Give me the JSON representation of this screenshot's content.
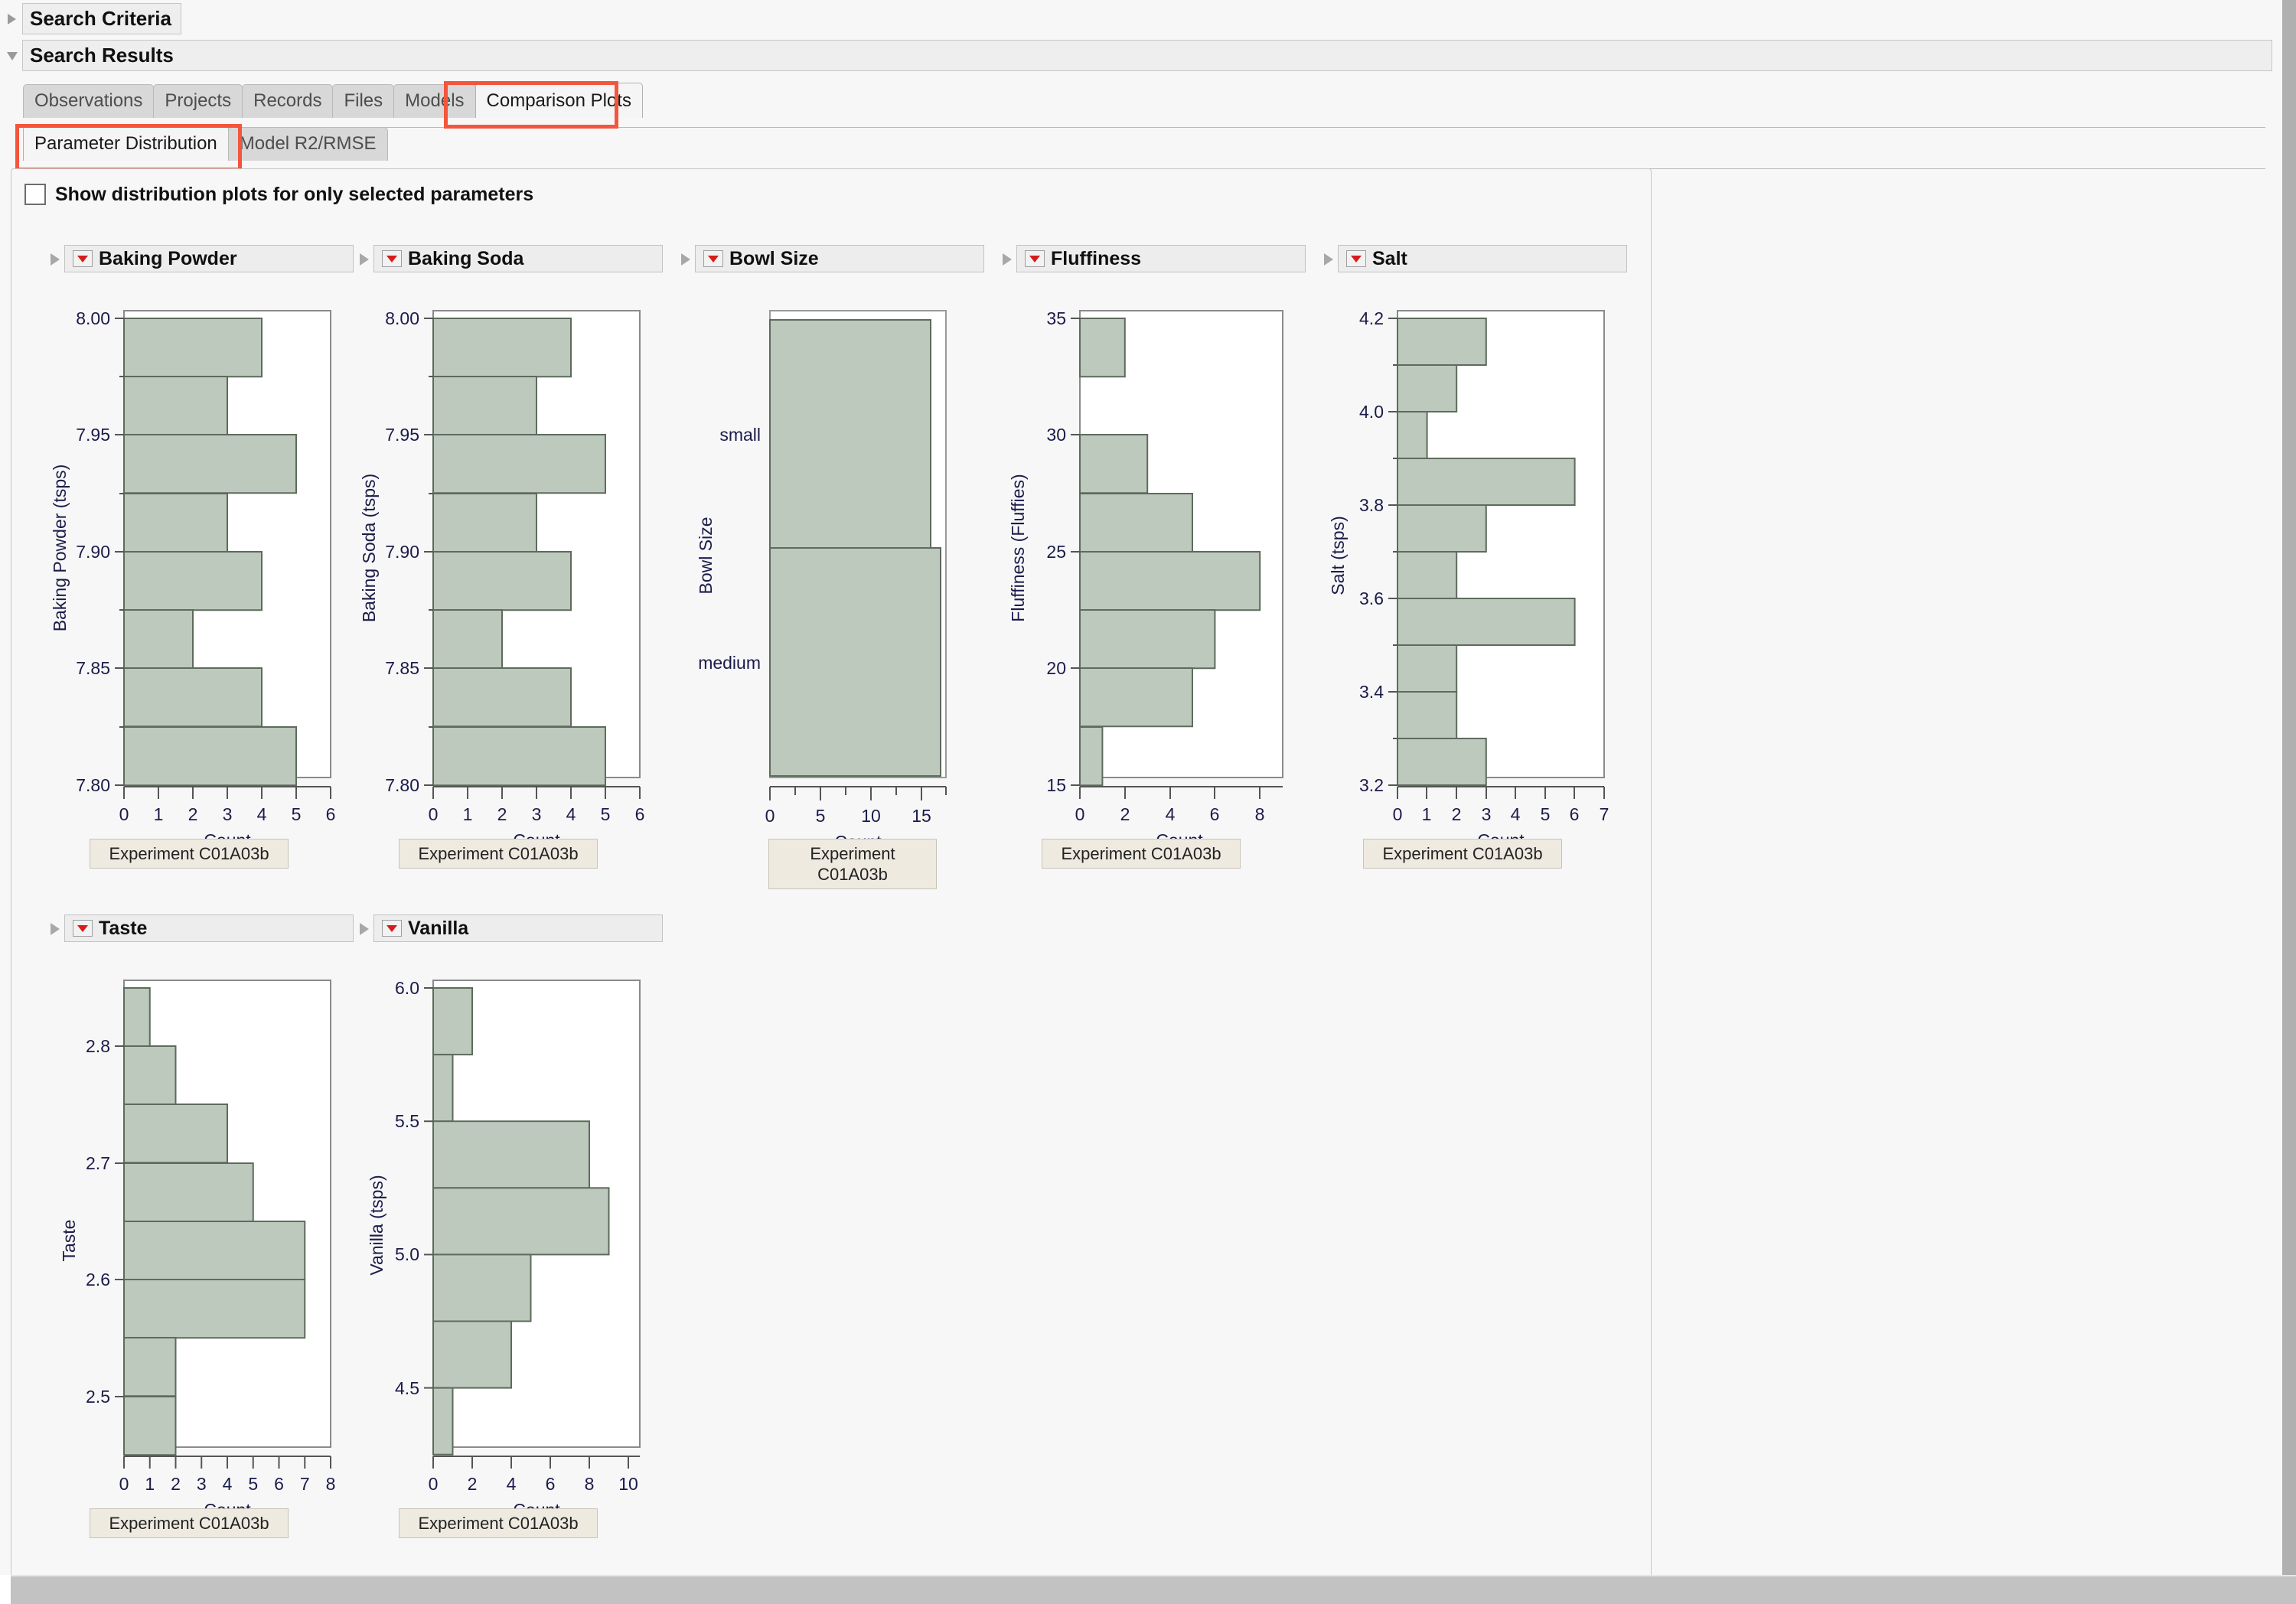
{
  "window": {
    "sections": [
      {
        "name": "search-criteria",
        "title": "Search Criteria",
        "expanded": false
      },
      {
        "name": "search-results",
        "title": "Search Results",
        "expanded": true
      }
    ]
  },
  "tabs_primary": {
    "items": [
      {
        "label": "Observations",
        "active": false
      },
      {
        "label": "Projects",
        "active": false
      },
      {
        "label": "Records",
        "active": false
      },
      {
        "label": "Files",
        "active": false
      },
      {
        "label": "Models",
        "active": false
      },
      {
        "label": "Comparison Plots",
        "active": true
      }
    ],
    "highlight_color": "#f4553d"
  },
  "tabs_secondary": {
    "items": [
      {
        "label": "Parameter Distribution",
        "active": true
      },
      {
        "label": "Model R2/RMSE",
        "active": false
      }
    ]
  },
  "options": {
    "show_selected_only_label": "Show distribution plots for only selected parameters",
    "show_selected_only_checked": false
  },
  "colors": {
    "bar_fill": "#bdc9bc",
    "bar_stroke": "#5d6b5d",
    "axis": "#555555",
    "tick_text": "#1b1b4a",
    "panel_bg": "#f7f7f7",
    "highlight": "#f4553d"
  },
  "plots": [
    {
      "name": "baking-powder",
      "title": "Baking Powder",
      "experiment_label": "Experiment C01A03b",
      "experiment_label_wrapped": false
    },
    {
      "name": "baking-soda",
      "title": "Baking Soda",
      "experiment_label": "Experiment C01A03b",
      "experiment_label_wrapped": false
    },
    {
      "name": "bowl-size",
      "title": "Bowl Size",
      "experiment_label": "Experiment\nC01A03b",
      "experiment_label_wrapped": true
    },
    {
      "name": "fluffiness",
      "title": "Fluffiness",
      "experiment_label": "Experiment C01A03b",
      "experiment_label_wrapped": false
    },
    {
      "name": "salt",
      "title": "Salt",
      "experiment_label": "Experiment C01A03b",
      "experiment_label_wrapped": false
    },
    {
      "name": "taste",
      "title": "Taste",
      "experiment_label": "Experiment C01A03b",
      "experiment_label_wrapped": false
    },
    {
      "name": "vanilla",
      "title": "Vanilla",
      "experiment_label": "Experiment C01A03b",
      "experiment_label_wrapped": false
    }
  ],
  "chart_data": [
    {
      "name": "baking-powder",
      "type": "bar",
      "orientation": "horizontal",
      "title": "Baking Powder",
      "ylabel": "Baking Powder (tsps)",
      "xlabel": "Count",
      "ylim": [
        7.775,
        8.0
      ],
      "xlim": [
        0,
        6
      ],
      "ytick_labels": [
        "7.80",
        "7.85",
        "7.90",
        "7.95",
        "8.00"
      ],
      "ytick_values": [
        7.8,
        7.85,
        7.9,
        7.95,
        8.0
      ],
      "xtick_labels": [
        "0",
        "1",
        "2",
        "3",
        "4",
        "5",
        "6"
      ],
      "xtick_values": [
        0,
        1,
        2,
        3,
        4,
        5,
        6
      ],
      "bin_width": 0.025,
      "bins": [
        {
          "lo": 7.975,
          "hi": 8.0,
          "count": 4
        },
        {
          "lo": 7.95,
          "hi": 7.975,
          "count": 3
        },
        {
          "lo": 7.925,
          "hi": 7.95,
          "count": 5
        },
        {
          "lo": 7.9,
          "hi": 7.925,
          "count": 3
        },
        {
          "lo": 7.875,
          "hi": 7.9,
          "count": 4
        },
        {
          "lo": 7.85,
          "hi": 7.875,
          "count": 2
        },
        {
          "lo": 7.825,
          "hi": 7.85,
          "count": 4
        },
        {
          "lo": 7.8,
          "hi": 7.825,
          "count": 5
        }
      ],
      "grid": false
    },
    {
      "name": "baking-soda",
      "type": "bar",
      "orientation": "horizontal",
      "title": "Baking Soda",
      "ylabel": "Baking Soda (tsps)",
      "xlabel": "Count",
      "ylim": [
        7.775,
        8.0
      ],
      "xlim": [
        0,
        6
      ],
      "ytick_labels": [
        "7.80",
        "7.85",
        "7.90",
        "7.95",
        "8.00"
      ],
      "ytick_values": [
        7.8,
        7.85,
        7.9,
        7.95,
        8.0
      ],
      "xtick_labels": [
        "0",
        "1",
        "2",
        "3",
        "4",
        "5",
        "6"
      ],
      "xtick_values": [
        0,
        1,
        2,
        3,
        4,
        5,
        6
      ],
      "bin_width": 0.025,
      "bins": [
        {
          "lo": 7.975,
          "hi": 8.0,
          "count": 4
        },
        {
          "lo": 7.95,
          "hi": 7.975,
          "count": 3
        },
        {
          "lo": 7.925,
          "hi": 7.95,
          "count": 5
        },
        {
          "lo": 7.9,
          "hi": 7.925,
          "count": 3
        },
        {
          "lo": 7.875,
          "hi": 7.9,
          "count": 4
        },
        {
          "lo": 7.85,
          "hi": 7.875,
          "count": 2
        },
        {
          "lo": 7.825,
          "hi": 7.85,
          "count": 4
        },
        {
          "lo": 7.8,
          "hi": 7.825,
          "count": 5
        }
      ],
      "grid": false
    },
    {
      "name": "bowl-size",
      "type": "bar",
      "orientation": "horizontal",
      "title": "Bowl Size",
      "ylabel": "Bowl Size",
      "xlabel": "Count",
      "categories": [
        "small",
        "medium"
      ],
      "values": [
        16,
        17
      ],
      "xlim": [
        0,
        17.5
      ],
      "xtick_labels": [
        "0",
        "5",
        "10",
        "15"
      ],
      "xtick_values": [
        0,
        5,
        10,
        15
      ],
      "grid": false
    },
    {
      "name": "fluffiness",
      "type": "bar",
      "orientation": "horizontal",
      "title": "Fluffiness",
      "ylabel": "Fluffiness (Fluffies)",
      "xlabel": "Count",
      "ylim": [
        15,
        35
      ],
      "xlim": [
        0,
        9
      ],
      "ytick_labels": [
        "15",
        "20",
        "25",
        "30",
        "35"
      ],
      "ytick_values": [
        15,
        20,
        25,
        30,
        35
      ],
      "xtick_labels": [
        "0",
        "2",
        "4",
        "6",
        "8"
      ],
      "xtick_values": [
        0,
        2,
        4,
        6,
        8
      ],
      "bin_width": 2.5,
      "bins": [
        {
          "lo": 32.5,
          "hi": 35.0,
          "count": 2
        },
        {
          "lo": 30.0,
          "hi": 32.5,
          "count": 0
        },
        {
          "lo": 27.5,
          "hi": 30.0,
          "count": 3
        },
        {
          "lo": 25.0,
          "hi": 27.5,
          "count": 5
        },
        {
          "lo": 22.5,
          "hi": 25.0,
          "count": 8
        },
        {
          "lo": 20.0,
          "hi": 22.5,
          "count": 6
        },
        {
          "lo": 17.5,
          "hi": 20.0,
          "count": 5
        },
        {
          "lo": 15.0,
          "hi": 17.5,
          "count": 1
        }
      ],
      "grid": false
    },
    {
      "name": "salt",
      "type": "bar",
      "orientation": "horizontal",
      "title": "Salt",
      "ylabel": "Salt (tsps)",
      "xlabel": "Count",
      "ylim": [
        3.15,
        4.25
      ],
      "xlim": [
        0,
        7
      ],
      "ytick_labels": [
        "3.2",
        "3.4",
        "3.6",
        "3.8",
        "4.0",
        "4.2"
      ],
      "ytick_values": [
        3.2,
        3.4,
        3.6,
        3.8,
        4.0,
        4.2
      ],
      "xtick_labels": [
        "0",
        "1",
        "2",
        "3",
        "4",
        "5",
        "6",
        "7"
      ],
      "xtick_values": [
        0,
        1,
        2,
        3,
        4,
        5,
        6,
        7
      ],
      "bin_width": 0.1,
      "bins": [
        {
          "lo": 4.15,
          "hi": 4.25,
          "count": 3
        },
        {
          "lo": 4.05,
          "hi": 4.15,
          "count": 2
        },
        {
          "lo": 3.95,
          "hi": 4.05,
          "count": 1
        },
        {
          "lo": 3.85,
          "hi": 3.95,
          "count": 6
        },
        {
          "lo": 3.75,
          "hi": 3.85,
          "count": 3
        },
        {
          "lo": 3.65,
          "hi": 3.75,
          "count": 2
        },
        {
          "lo": 3.55,
          "hi": 3.65,
          "count": 6
        },
        {
          "lo": 3.45,
          "hi": 3.55,
          "count": 2
        },
        {
          "lo": 3.35,
          "hi": 3.45,
          "count": 2
        },
        {
          "lo": 3.25,
          "hi": 3.35,
          "count": 3
        }
      ],
      "grid": false
    },
    {
      "name": "taste",
      "type": "bar",
      "orientation": "horizontal",
      "title": "Taste",
      "ylabel": "Taste",
      "xlabel": "Count",
      "ylim": [
        2.45,
        2.85
      ],
      "xlim": [
        0,
        8
      ],
      "ytick_labels": [
        "2.5",
        "2.6",
        "2.7",
        "2.8"
      ],
      "ytick_values": [
        2.5,
        2.6,
        2.7,
        2.8
      ],
      "xtick_labels": [
        "0",
        "1",
        "2",
        "3",
        "4",
        "5",
        "6",
        "7",
        "8"
      ],
      "xtick_values": [
        0,
        1,
        2,
        3,
        4,
        5,
        6,
        7,
        8
      ],
      "bin_width": 0.05,
      "bins": [
        {
          "lo": 2.8,
          "hi": 2.85,
          "count": 1
        },
        {
          "lo": 2.75,
          "hi": 2.8,
          "count": 2
        },
        {
          "lo": 2.7,
          "hi": 2.75,
          "count": 4
        },
        {
          "lo": 2.65,
          "hi": 2.7,
          "count": 5
        },
        {
          "lo": 2.6,
          "hi": 2.65,
          "count": 7
        },
        {
          "lo": 2.55,
          "hi": 2.6,
          "count": 7
        },
        {
          "lo": 2.5,
          "hi": 2.55,
          "count": 2
        },
        {
          "lo": 2.45,
          "hi": 2.5,
          "count": 2
        }
      ],
      "grid": false
    },
    {
      "name": "vanilla",
      "type": "bar",
      "orientation": "horizontal",
      "title": "Vanilla",
      "ylabel": "Vanilla (tsps)",
      "xlabel": "Count",
      "ylim": [
        4.25,
        6.0
      ],
      "xlim": [
        0,
        10.6
      ],
      "ytick_labels": [
        "4.5",
        "5.0",
        "5.5",
        "6.0"
      ],
      "ytick_values": [
        4.5,
        5.0,
        5.5,
        6.0
      ],
      "xtick_labels": [
        "0",
        "2",
        "4",
        "6",
        "8",
        "10"
      ],
      "xtick_values": [
        0,
        2,
        4,
        6,
        8,
        10
      ],
      "bin_width": 0.25,
      "bins": [
        {
          "lo": 5.75,
          "hi": 6.0,
          "count": 2
        },
        {
          "lo": 5.5,
          "hi": 5.75,
          "count": 1
        },
        {
          "lo": 5.25,
          "hi": 5.5,
          "count": 8
        },
        {
          "lo": 5.0,
          "hi": 5.25,
          "count": 9
        },
        {
          "lo": 4.75,
          "hi": 5.0,
          "count": 5
        },
        {
          "lo": 4.5,
          "hi": 4.75,
          "count": 4
        },
        {
          "lo": 4.25,
          "hi": 4.5,
          "count": 1
        }
      ],
      "grid": false
    }
  ]
}
